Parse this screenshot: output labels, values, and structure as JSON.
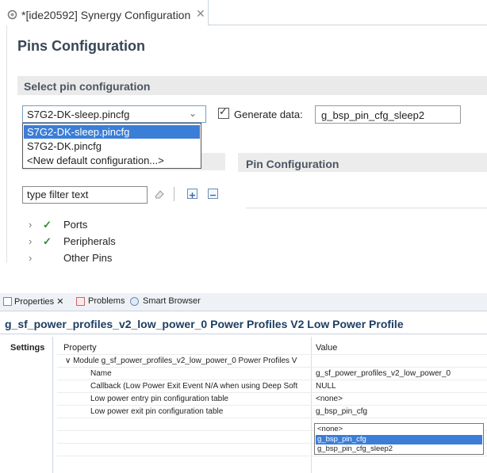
{
  "editor": {
    "tab_title": "*[ide20592] Synergy Configuration",
    "tab_close": "✕",
    "page_title": "Pins Configuration",
    "section_title": "Select pin configuration",
    "config_select_value": "S7G2-DK-sleep.pincfg",
    "generate_label": "Generate data:",
    "generate_checked": true,
    "generate_value": "g_bsp_pin_cfg_sleep2",
    "dropdown_options": [
      "S7G2-DK-sleep.pincfg",
      "S7G2-DK.pincfg",
      "<New default configuration...>"
    ],
    "pin_config_title": "Pin Configuration",
    "filter_value": "type filter text",
    "tree": [
      {
        "label": "Ports",
        "checked": true
      },
      {
        "label": "Peripherals",
        "checked": true
      },
      {
        "label": "Other Pins",
        "checked": false
      }
    ]
  },
  "properties": {
    "tabs": [
      {
        "label": "Properties ✕",
        "icon": "properties-icon"
      },
      {
        "label": "Problems",
        "icon": "problems-icon"
      },
      {
        "label": "Smart Browser",
        "icon": "smart-browser-icon"
      }
    ],
    "title": "g_sf_power_profiles_v2_low_power_0 Power Profiles V2 Low Power Profile",
    "settings_tab": "Settings",
    "col_property": "Property",
    "col_value": "Value",
    "rows": [
      {
        "property": "∨ Module g_sf_power_profiles_v2_low_power_0 Power Profiles V",
        "value": ""
      },
      {
        "property": "Name",
        "value": "g_sf_power_profiles_v2_low_power_0"
      },
      {
        "property": "Callback (Low Power Exit Event N/A when using Deep Soft",
        "value": "NULL"
      },
      {
        "property": "Low power entry pin configuration table",
        "value": "<none>"
      },
      {
        "property": "Low power exit pin configuration table",
        "value": "g_bsp_pin_cfg"
      }
    ],
    "value_options": [
      "<none>",
      "g_bsp_pin_cfg",
      "g_bsp_pin_cfg_sleep2"
    ]
  },
  "colors": {
    "accent": "#3b7ed7",
    "title_blue": "#1e3e62",
    "check_green": "#2e8b2e"
  }
}
